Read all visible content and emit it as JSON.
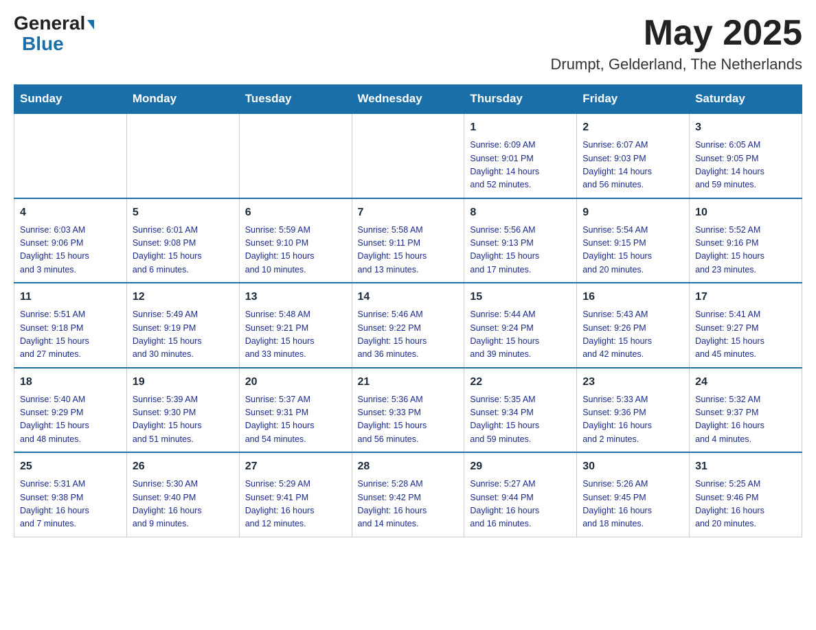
{
  "header": {
    "logo_general": "General",
    "logo_blue": "Blue",
    "title": "May 2025",
    "subtitle": "Drumpt, Gelderland, The Netherlands"
  },
  "weekdays": [
    "Sunday",
    "Monday",
    "Tuesday",
    "Wednesday",
    "Thursday",
    "Friday",
    "Saturday"
  ],
  "weeks": [
    [
      {
        "day": "",
        "info": ""
      },
      {
        "day": "",
        "info": ""
      },
      {
        "day": "",
        "info": ""
      },
      {
        "day": "",
        "info": ""
      },
      {
        "day": "1",
        "info": "Sunrise: 6:09 AM\nSunset: 9:01 PM\nDaylight: 14 hours\nand 52 minutes."
      },
      {
        "day": "2",
        "info": "Sunrise: 6:07 AM\nSunset: 9:03 PM\nDaylight: 14 hours\nand 56 minutes."
      },
      {
        "day": "3",
        "info": "Sunrise: 6:05 AM\nSunset: 9:05 PM\nDaylight: 14 hours\nand 59 minutes."
      }
    ],
    [
      {
        "day": "4",
        "info": "Sunrise: 6:03 AM\nSunset: 9:06 PM\nDaylight: 15 hours\nand 3 minutes."
      },
      {
        "day": "5",
        "info": "Sunrise: 6:01 AM\nSunset: 9:08 PM\nDaylight: 15 hours\nand 6 minutes."
      },
      {
        "day": "6",
        "info": "Sunrise: 5:59 AM\nSunset: 9:10 PM\nDaylight: 15 hours\nand 10 minutes."
      },
      {
        "day": "7",
        "info": "Sunrise: 5:58 AM\nSunset: 9:11 PM\nDaylight: 15 hours\nand 13 minutes."
      },
      {
        "day": "8",
        "info": "Sunrise: 5:56 AM\nSunset: 9:13 PM\nDaylight: 15 hours\nand 17 minutes."
      },
      {
        "day": "9",
        "info": "Sunrise: 5:54 AM\nSunset: 9:15 PM\nDaylight: 15 hours\nand 20 minutes."
      },
      {
        "day": "10",
        "info": "Sunrise: 5:52 AM\nSunset: 9:16 PM\nDaylight: 15 hours\nand 23 minutes."
      }
    ],
    [
      {
        "day": "11",
        "info": "Sunrise: 5:51 AM\nSunset: 9:18 PM\nDaylight: 15 hours\nand 27 minutes."
      },
      {
        "day": "12",
        "info": "Sunrise: 5:49 AM\nSunset: 9:19 PM\nDaylight: 15 hours\nand 30 minutes."
      },
      {
        "day": "13",
        "info": "Sunrise: 5:48 AM\nSunset: 9:21 PM\nDaylight: 15 hours\nand 33 minutes."
      },
      {
        "day": "14",
        "info": "Sunrise: 5:46 AM\nSunset: 9:22 PM\nDaylight: 15 hours\nand 36 minutes."
      },
      {
        "day": "15",
        "info": "Sunrise: 5:44 AM\nSunset: 9:24 PM\nDaylight: 15 hours\nand 39 minutes."
      },
      {
        "day": "16",
        "info": "Sunrise: 5:43 AM\nSunset: 9:26 PM\nDaylight: 15 hours\nand 42 minutes."
      },
      {
        "day": "17",
        "info": "Sunrise: 5:41 AM\nSunset: 9:27 PM\nDaylight: 15 hours\nand 45 minutes."
      }
    ],
    [
      {
        "day": "18",
        "info": "Sunrise: 5:40 AM\nSunset: 9:29 PM\nDaylight: 15 hours\nand 48 minutes."
      },
      {
        "day": "19",
        "info": "Sunrise: 5:39 AM\nSunset: 9:30 PM\nDaylight: 15 hours\nand 51 minutes."
      },
      {
        "day": "20",
        "info": "Sunrise: 5:37 AM\nSunset: 9:31 PM\nDaylight: 15 hours\nand 54 minutes."
      },
      {
        "day": "21",
        "info": "Sunrise: 5:36 AM\nSunset: 9:33 PM\nDaylight: 15 hours\nand 56 minutes."
      },
      {
        "day": "22",
        "info": "Sunrise: 5:35 AM\nSunset: 9:34 PM\nDaylight: 15 hours\nand 59 minutes."
      },
      {
        "day": "23",
        "info": "Sunrise: 5:33 AM\nSunset: 9:36 PM\nDaylight: 16 hours\nand 2 minutes."
      },
      {
        "day": "24",
        "info": "Sunrise: 5:32 AM\nSunset: 9:37 PM\nDaylight: 16 hours\nand 4 minutes."
      }
    ],
    [
      {
        "day": "25",
        "info": "Sunrise: 5:31 AM\nSunset: 9:38 PM\nDaylight: 16 hours\nand 7 minutes."
      },
      {
        "day": "26",
        "info": "Sunrise: 5:30 AM\nSunset: 9:40 PM\nDaylight: 16 hours\nand 9 minutes."
      },
      {
        "day": "27",
        "info": "Sunrise: 5:29 AM\nSunset: 9:41 PM\nDaylight: 16 hours\nand 12 minutes."
      },
      {
        "day": "28",
        "info": "Sunrise: 5:28 AM\nSunset: 9:42 PM\nDaylight: 16 hours\nand 14 minutes."
      },
      {
        "day": "29",
        "info": "Sunrise: 5:27 AM\nSunset: 9:44 PM\nDaylight: 16 hours\nand 16 minutes."
      },
      {
        "day": "30",
        "info": "Sunrise: 5:26 AM\nSunset: 9:45 PM\nDaylight: 16 hours\nand 18 minutes."
      },
      {
        "day": "31",
        "info": "Sunrise: 5:25 AM\nSunset: 9:46 PM\nDaylight: 16 hours\nand 20 minutes."
      }
    ]
  ]
}
